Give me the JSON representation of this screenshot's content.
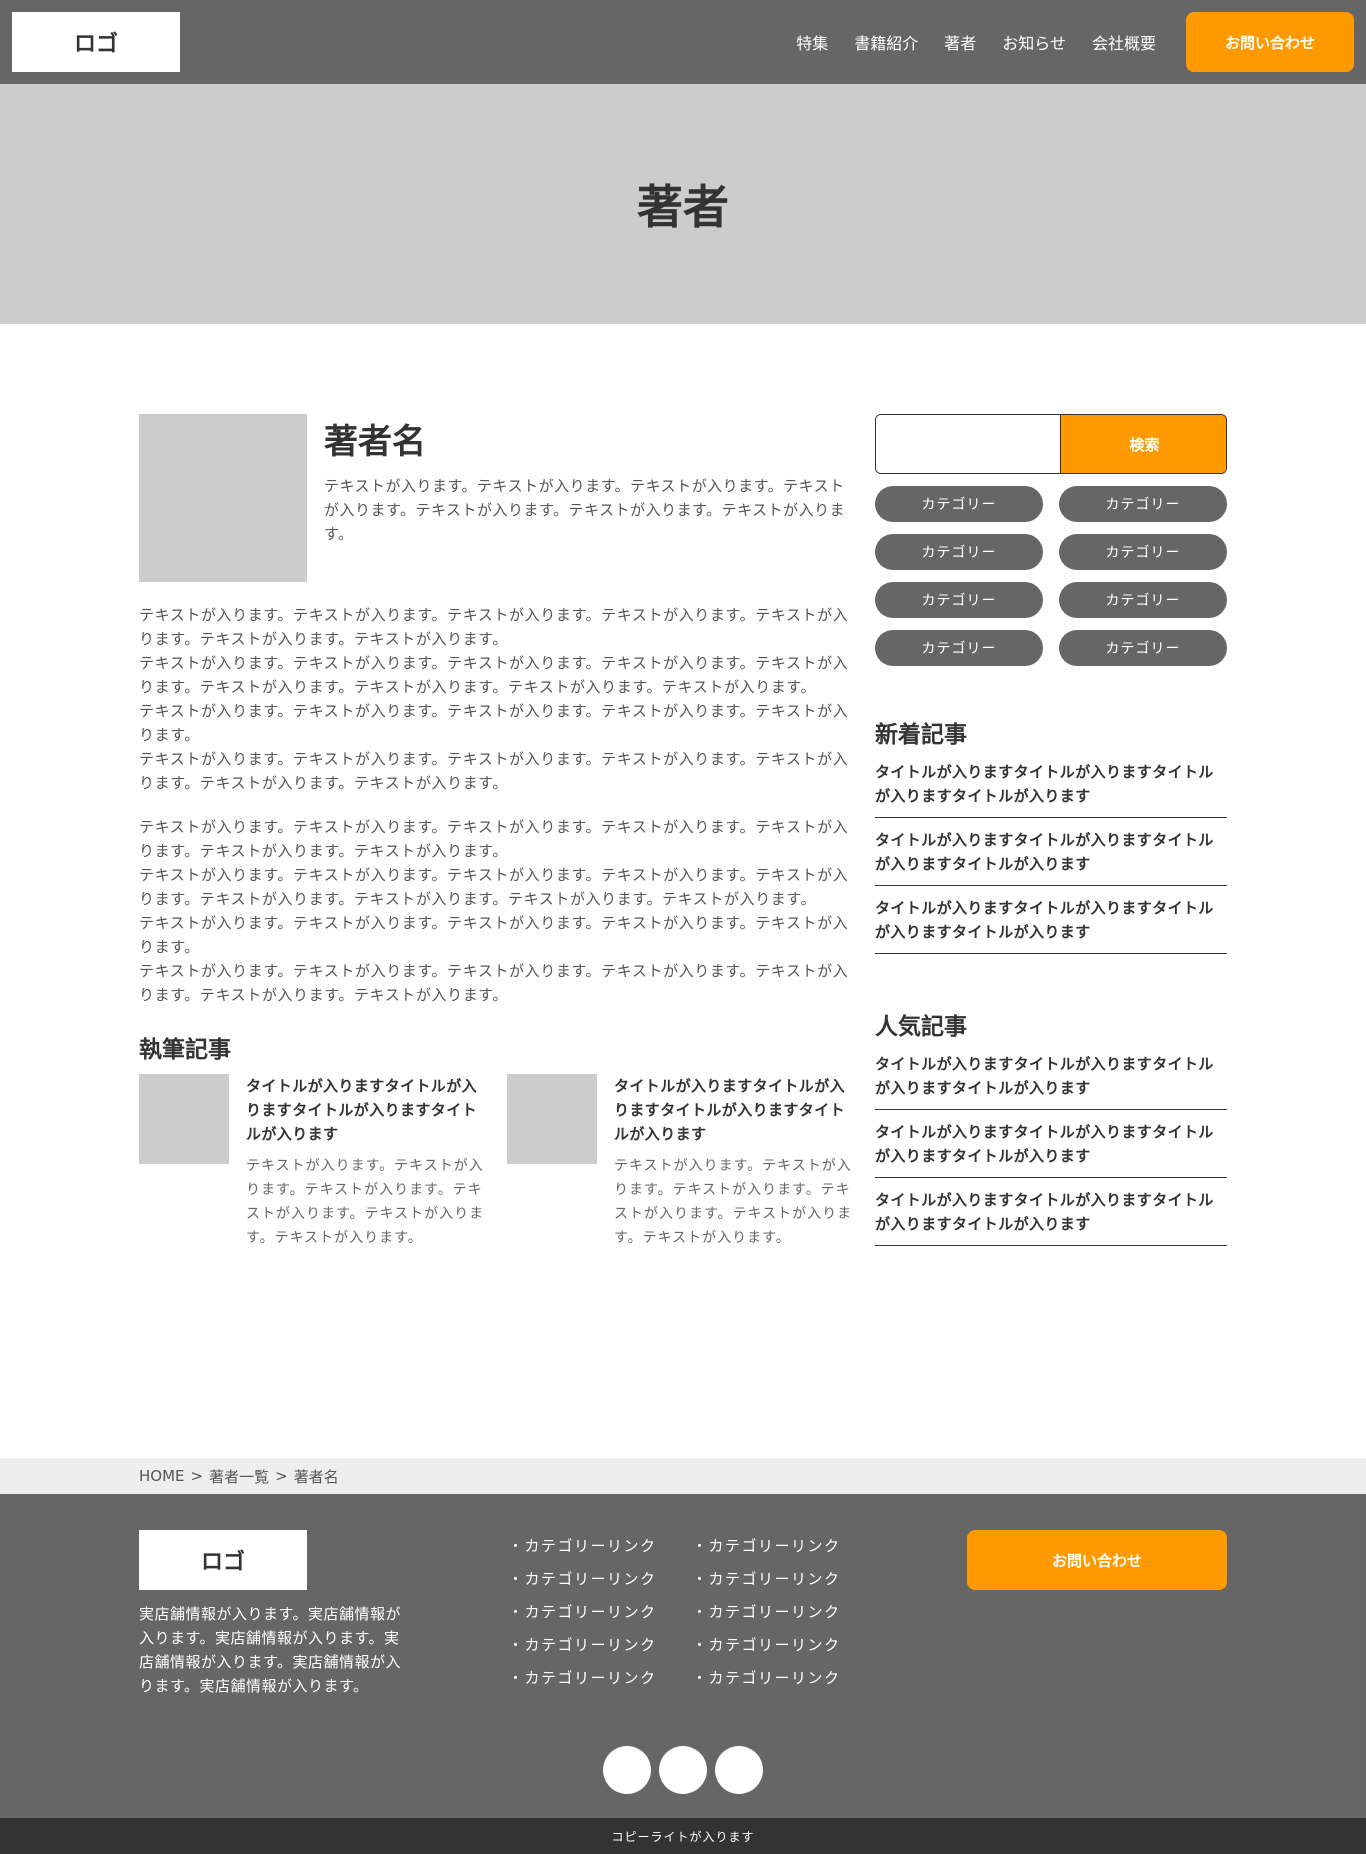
{
  "header": {
    "logo": "ロゴ",
    "nav": [
      "特集",
      "書籍紹介",
      "著者",
      "お知らせ",
      "会社概要"
    ],
    "contact": "お問い合わせ"
  },
  "hero": {
    "title": "著者"
  },
  "author": {
    "name": "著者名",
    "lead": "テキストが入ります。テキストが入ります。テキストが入ります。テキストが入ります。テキストが入ります。テキストが入ります。テキストが入ります。",
    "para1": "テキストが入ります。テキストが入ります。テキストが入ります。テキストが入ります。テキストが入ります。テキストが入ります。テキストが入ります。\nテキストが入ります。テキストが入ります。テキストが入ります。テキストが入ります。テキストが入ります。テキストが入ります。テキストが入ります。テキストが入ります。テキストが入ります。\nテキストが入ります。テキストが入ります。テキストが入ります。テキストが入ります。テキストが入ります。\nテキストが入ります。テキストが入ります。テキストが入ります。テキストが入ります。テキストが入ります。テキストが入ります。テキストが入ります。",
    "para2": "テキストが入ります。テキストが入ります。テキストが入ります。テキストが入ります。テキストが入ります。テキストが入ります。テキストが入ります。\nテキストが入ります。テキストが入ります。テキストが入ります。テキストが入ります。テキストが入ります。テキストが入ります。テキストが入ります。テキストが入ります。テキストが入ります。\nテキストが入ります。テキストが入ります。テキストが入ります。テキストが入ります。テキストが入ります。\nテキストが入ります。テキストが入ります。テキストが入ります。テキストが入ります。テキストが入ります。テキストが入ります。テキストが入ります。"
  },
  "writing": {
    "title": "執筆記事",
    "articles": [
      {
        "title": "タイトルが入りますタイトルが入りますタイトルが入りますタイトルが入ります",
        "text": "テキストが入ります。テキストが入ります。テキストが入ります。テキストが入ります。テキストが入ります。テキストが入ります。"
      },
      {
        "title": "タイトルが入りますタイトルが入りますタイトルが入りますタイトルが入ります",
        "text": "テキストが入ります。テキストが入ります。テキストが入ります。テキストが入ります。テキストが入ります。テキストが入ります。"
      }
    ]
  },
  "sidebar": {
    "search_button": "検索",
    "search_value": "",
    "categories": [
      "カテゴリー",
      "カテゴリー",
      "カテゴリー",
      "カテゴリー",
      "カテゴリー",
      "カテゴリー",
      "カテゴリー",
      "カテゴリー"
    ],
    "new_title": "新着記事",
    "new_items": [
      "タイトルが入りますタイトルが入りますタイトルが入りますタイトルが入ります",
      "タイトルが入りますタイトルが入りますタイトルが入りますタイトルが入ります",
      "タイトルが入りますタイトルが入りますタイトルが入りますタイトルが入ります"
    ],
    "popular_title": "人気記事",
    "popular_items": [
      "タイトルが入りますタイトルが入りますタイトルが入りますタイトルが入ります",
      "タイトルが入りますタイトルが入りますタイトルが入りますタイトルが入ります",
      "タイトルが入りますタイトルが入りますタイトルが入りますタイトルが入ります"
    ]
  },
  "breadcrumb": {
    "items": [
      "HOME",
      "著者一覧",
      "著者名"
    ],
    "separator": ">"
  },
  "footer": {
    "logo": "ロゴ",
    "info": "実店舗情報が入ります。実店舗情報が入ります。実店舗情報が入ります。実店舗情報が入ります。実店舗情報が入ります。実店舗情報が入ります。",
    "links_col1": [
      "・カテゴリーリンク",
      "・カテゴリーリンク",
      "・カテゴリーリンク",
      "・カテゴリーリンク",
      "・カテゴリーリンク"
    ],
    "links_col2": [
      "・カテゴリーリンク",
      "・カテゴリーリンク",
      "・カテゴリーリンク",
      "・カテゴリーリンク",
      "・カテゴリーリンク"
    ],
    "contact": "お問い合わせ",
    "copyright": "コピーライトが入ります"
  },
  "colors": {
    "accent": "#ff9900",
    "header_bg": "#666666",
    "hero_bg": "#cccccc",
    "copyright_bg": "#333333"
  }
}
